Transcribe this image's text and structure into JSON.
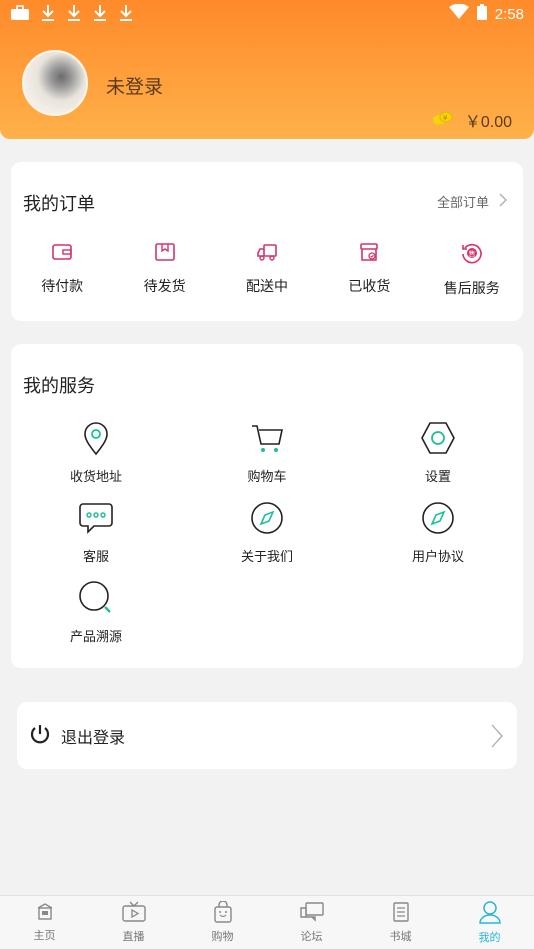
{
  "status_bar": {
    "time": "2:58",
    "notif_icons": [
      "briefcase-icon",
      "download-icon",
      "download-icon",
      "download-icon",
      "download-icon"
    ]
  },
  "profile": {
    "login_status": "未登录",
    "balance": "￥0.00"
  },
  "orders": {
    "title": "我的订单",
    "all_orders": "全部订单",
    "items": [
      {
        "label": "待付款",
        "icon": "wallet-icon"
      },
      {
        "label": "待发货",
        "icon": "package-icon"
      },
      {
        "label": "配送中",
        "icon": "truck-icon"
      },
      {
        "label": "已收货",
        "icon": "received-box-icon"
      },
      {
        "label": "售后服务",
        "icon": "after-sales-icon"
      }
    ]
  },
  "services": {
    "title": "我的服务",
    "items": [
      {
        "label": "收货地址",
        "icon": "location-pin-icon"
      },
      {
        "label": "购物车",
        "icon": "cart-icon"
      },
      {
        "label": "设置",
        "icon": "settings-hexagon-icon"
      },
      {
        "label": "客服",
        "icon": "chat-bubble-icon"
      },
      {
        "label": "关于我们",
        "icon": "compass-icon"
      },
      {
        "label": "用户协议",
        "icon": "compass-icon"
      },
      {
        "label": "产品溯源",
        "icon": "magnifier-icon"
      }
    ]
  },
  "logout": {
    "label": "退出登录"
  },
  "bottom_nav": [
    {
      "label": "主页",
      "icon": "home-icon"
    },
    {
      "label": "直播",
      "icon": "tv-icon"
    },
    {
      "label": "购物",
      "icon": "shopping-bag-icon"
    },
    {
      "label": "论坛",
      "icon": "forum-icon"
    },
    {
      "label": "书城",
      "icon": "book-icon"
    },
    {
      "label": "我的",
      "icon": "user-icon",
      "active": true
    }
  ],
  "colors": {
    "header_top": "#ff8a2a",
    "header_bottom": "#ffb14a",
    "accent_pink": "#d6336c",
    "accent_teal": "#1fbf9a",
    "nav_active": "#24b8d8"
  }
}
